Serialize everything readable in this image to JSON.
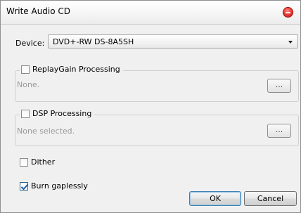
{
  "window": {
    "title": "Write Audio CD"
  },
  "device": {
    "label": "Device:",
    "selected": "DVD+-RW DS-8A5SH"
  },
  "replaygain": {
    "label": "ReplayGain Processing",
    "checked": false,
    "status": "None.",
    "button_label": "..."
  },
  "dsp": {
    "label": "DSP Processing",
    "checked": false,
    "status": "None selected.",
    "button_label": "..."
  },
  "dither": {
    "label": "Dither",
    "checked": false
  },
  "burn_gapless": {
    "label": "Burn gaplessly",
    "checked": true
  },
  "buttons": {
    "ok": "OK",
    "cancel": "Cancel"
  }
}
